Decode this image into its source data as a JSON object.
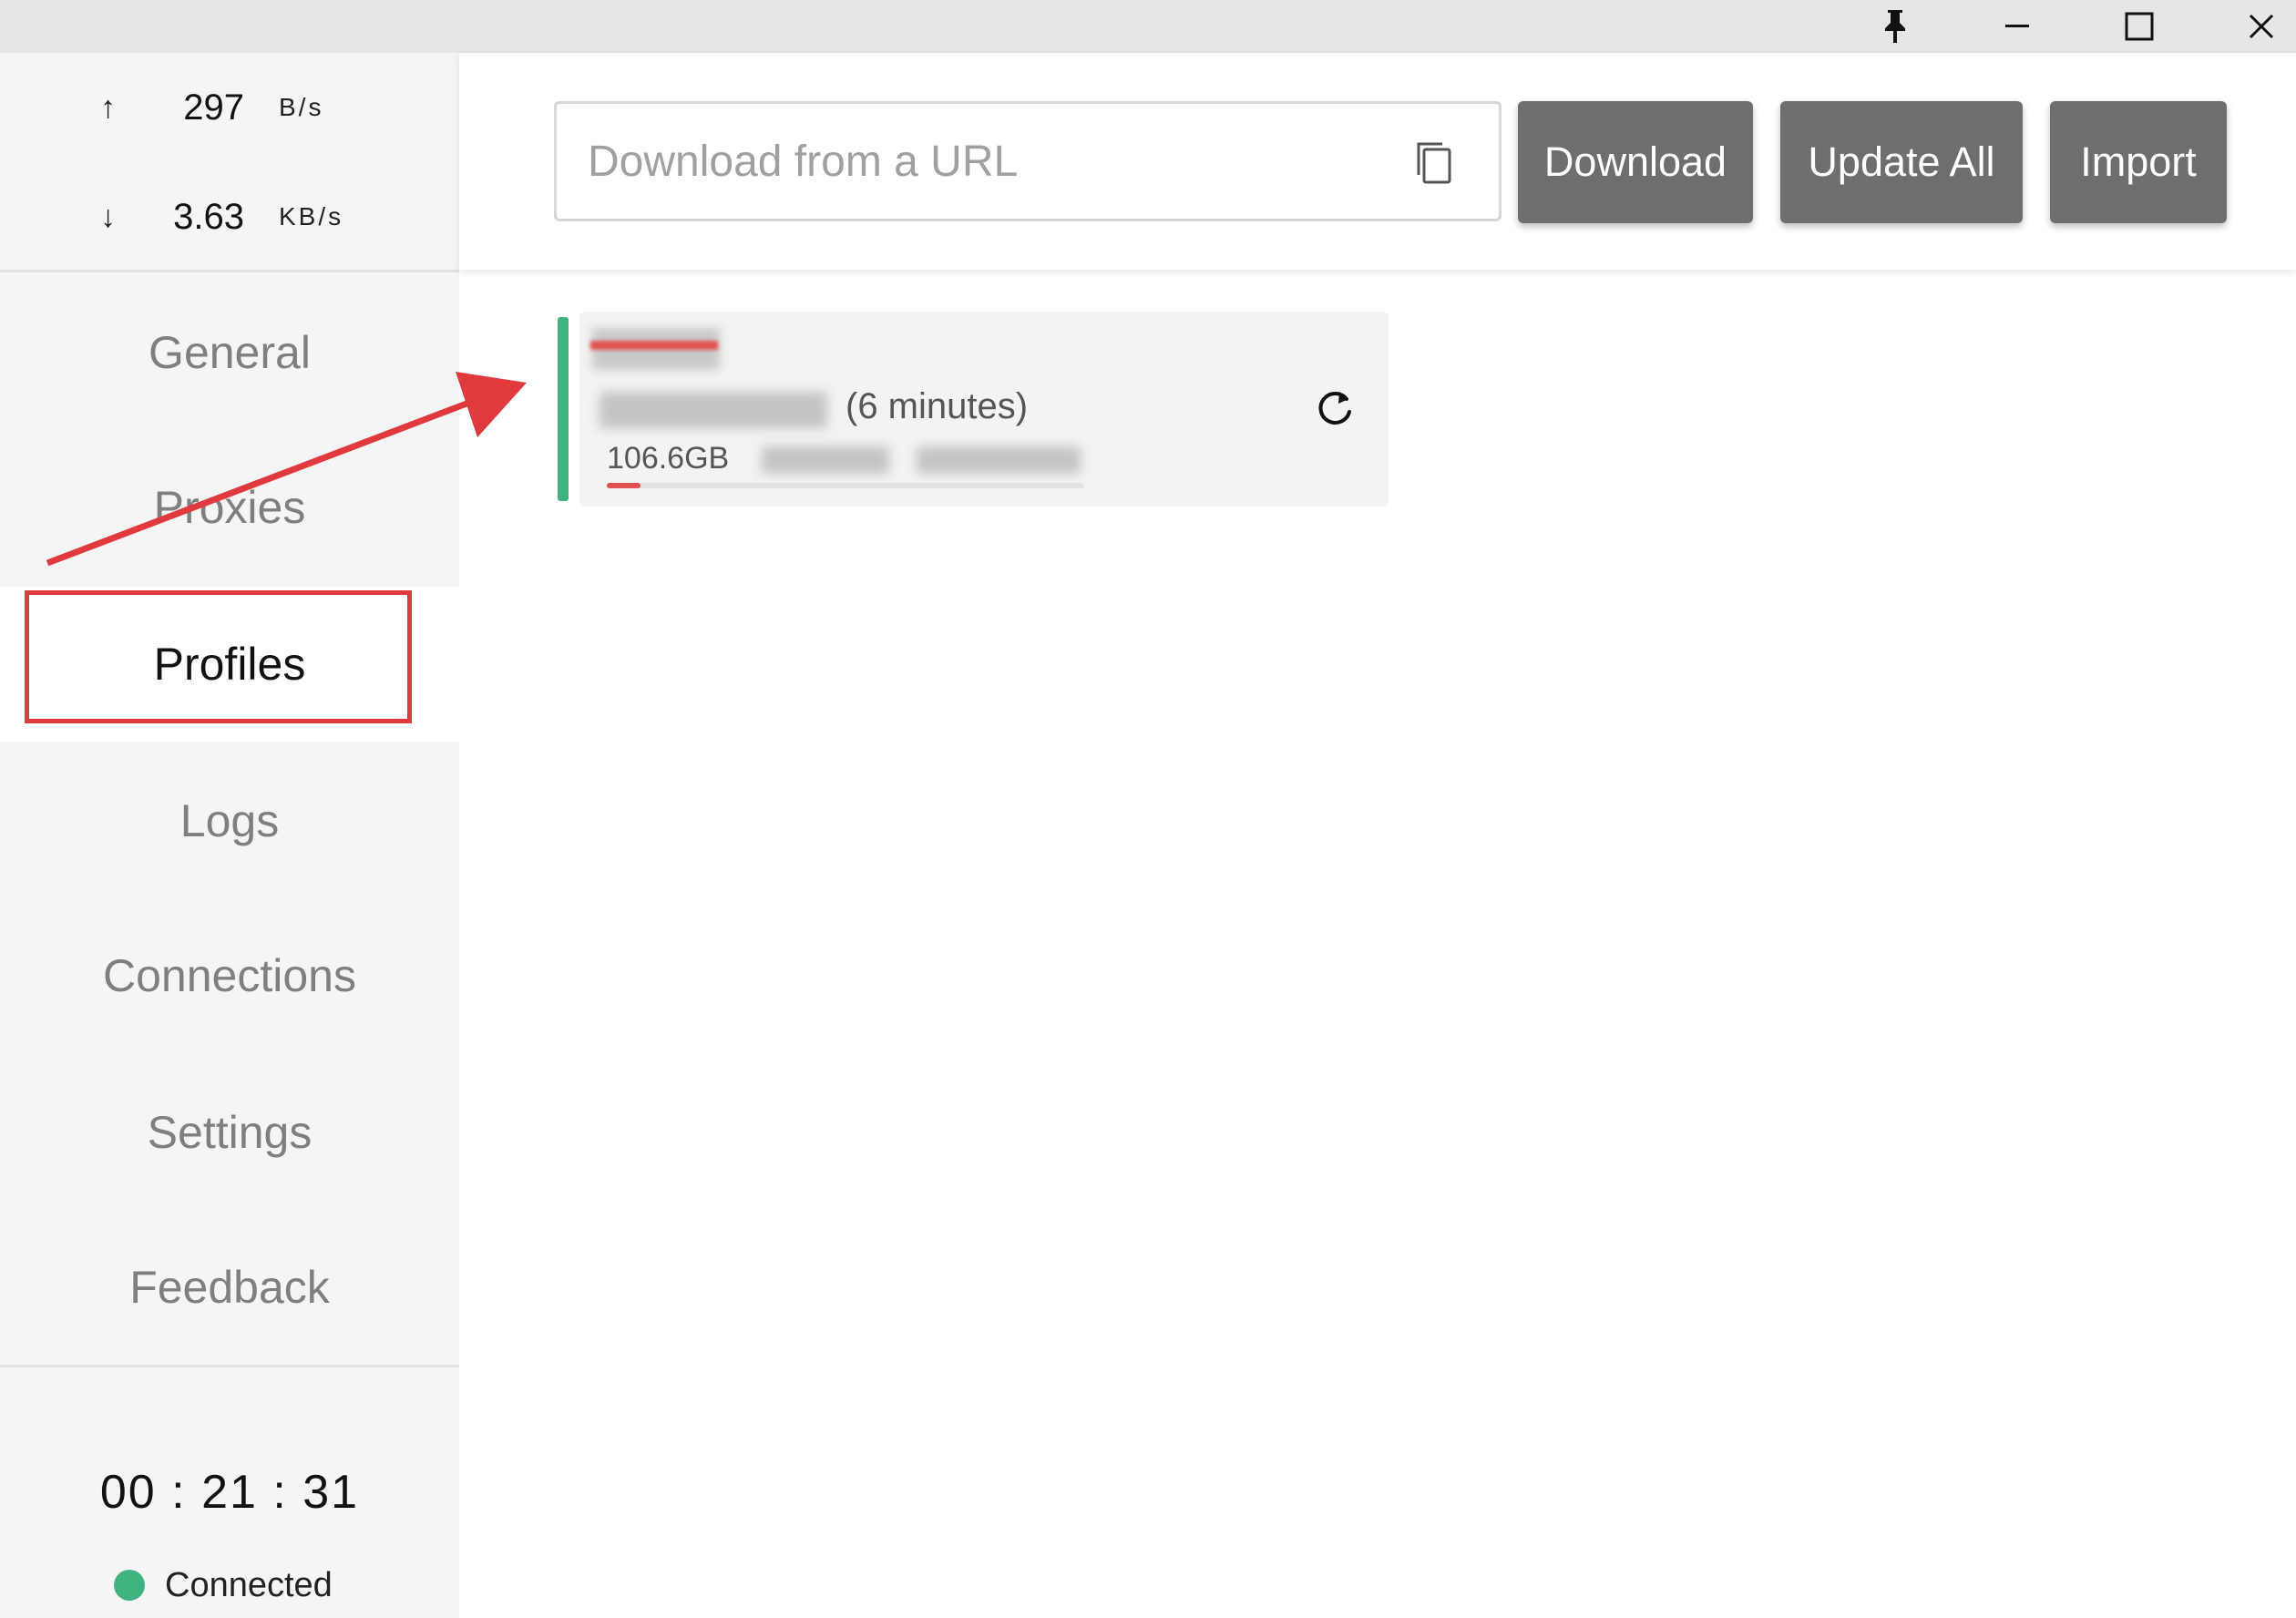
{
  "window": {
    "controls": [
      "pin-icon",
      "minimize-icon",
      "maximize-icon",
      "close-icon"
    ]
  },
  "traffic": {
    "upload": {
      "arrow": "↑",
      "value": "297",
      "unit": "B/s"
    },
    "download": {
      "arrow": "↓",
      "value": "3.63",
      "unit": "KB/s"
    }
  },
  "sidebar": {
    "items": [
      {
        "label": "General"
      },
      {
        "label": "Proxies"
      },
      {
        "label": "Profiles",
        "active": true
      },
      {
        "label": "Logs"
      },
      {
        "label": "Connections"
      },
      {
        "label": "Settings"
      },
      {
        "label": "Feedback"
      }
    ],
    "timer": "00 : 21 : 31",
    "status": "Connected"
  },
  "toolbar": {
    "url_placeholder": "Download from a URL",
    "url_value": "",
    "download_label": "Download",
    "update_all_label": "Update All",
    "import_label": "Import"
  },
  "profile": {
    "updated": "(6 minutes)",
    "size": "106.6GB",
    "usage_fraction": 0.07
  },
  "colors": {
    "accent_green": "#3fb37f",
    "annotation_red": "#e03a3e",
    "button_gray": "#6e6e6e",
    "sidebar_bg": "#f5f5f5"
  }
}
